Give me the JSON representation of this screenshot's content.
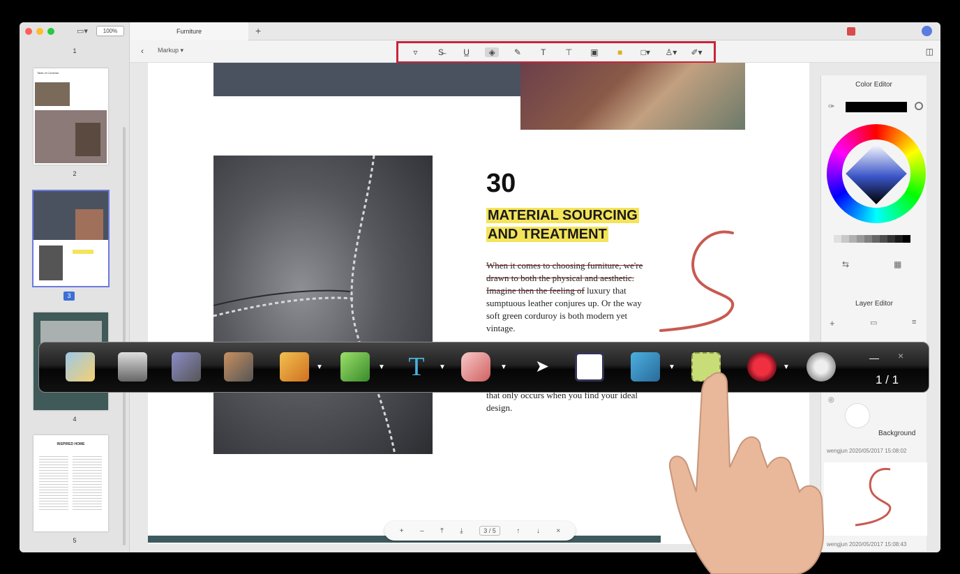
{
  "window": {
    "zoom": "100%",
    "tab_title": "Furniture",
    "tab_add": "+",
    "markup_menu": "Markup",
    "colors": {
      "accent": "#3b6fd6",
      "highlight": "#f3e45a",
      "toolbar_outline": "#c9243a"
    }
  },
  "sidebar": {
    "page_labels": [
      "1",
      "2",
      "3",
      "4",
      "5"
    ],
    "thumb_title_p5": "INSPIRED HOME",
    "thumb_title_p2": "Table of Contents"
  },
  "markup_tools": [
    "highlight-icon",
    "strikethrough-icon",
    "underline-icon",
    "eraser-icon",
    "pencil-icon",
    "text-icon",
    "textbox-icon",
    "callout-icon",
    "sticky-note-icon",
    "shape-icon",
    "stamp-icon",
    "signature-icon"
  ],
  "document": {
    "number": "30",
    "heading_line1": "MATERIAL SOURCING",
    "heading_line2": "AND TREATMENT",
    "body_struck": "When it comes to choosing furniture, we're drawn to both the physical and aesthetic. Imagine then the feeling of",
    "body_plain": "luxury that sumptuous leather conjures up. Or the way soft green corduroy is both modern yet vintage.",
    "body_tail": "that only occurs when you find your ideal design."
  },
  "bottom_nav": {
    "zoom_in": "+",
    "zoom_out": "–",
    "page_indicator": "3 / 5",
    "close": "×"
  },
  "right_panel": {
    "color_editor_title": "Color Editor",
    "layer_editor_title": "Layer Editor",
    "background_label": "Background",
    "layer_author": "wengjun",
    "layer_date_1": "2020/05/2017 15:08:02",
    "layer_date_2": "2020/05/2017 15:08:43",
    "color_value": "#000000"
  },
  "whiteboard_bar": {
    "page_indicator": "1 / 1",
    "minimize": "—",
    "close": "×",
    "tools": [
      "new-page-icon",
      "save-icon",
      "undo-icon",
      "redo-icon",
      "pencil-icon",
      "highlighter-icon",
      "text-icon",
      "eraser-icon",
      "select-arrow-icon",
      "whiteboard-icon",
      "wiper-icon",
      "screenshot-icon",
      "record-icon",
      "webcam-icon"
    ]
  }
}
